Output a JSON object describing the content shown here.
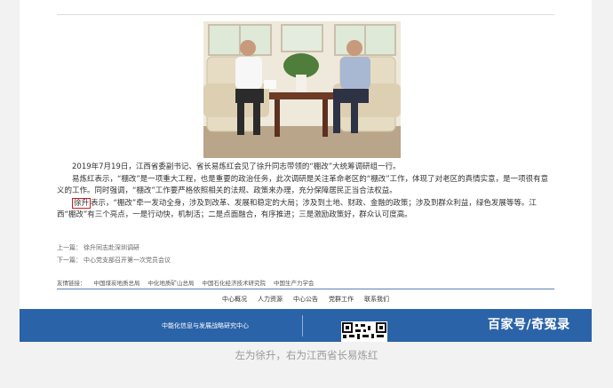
{
  "article": {
    "para1": "2019年7月19日，江西省委副书记、省长易炼红会见了徐升同志带领的“棚改”大统筹调研组一行。",
    "para2": "易炼红表示，“棚改”是一项重大工程，也是重要的政治任务，此次调研是关注革命老区的“棚改”工作，体现了对老区的真情实意，是一项很有意义的工作。同时强调，“棚改”工作要严格依照相关的法规、政策来办理，充分保障居民正当合法权益。",
    "para3_name": "徐升",
    "para3_rest": "表示，“棚改”牵一发动全身，涉及到改革、发展和稳定的大局；涉及到土地、财政、金融的政策；涉及到群众利益，绿色发展等等。江西“棚改”有三个亮点，一是行动快，机制活；二是点面融合，有序推进；三是激励政策好，群众认可度高。"
  },
  "nav": {
    "prev_label": "上一篇：",
    "prev_link": "徐升同志赴深圳调研",
    "next_label": "下一篇：",
    "next_link": "中心党支部召开第一次党员会议"
  },
  "friends": {
    "label": "友情链接：",
    "links": [
      "中国煤炭地质总局",
      "中化地质矿山总局",
      "中国石化经济技术研究院",
      "中国生产力学会"
    ]
  },
  "footer_nav": [
    "中心概况",
    "人力资源",
    "中心公告",
    "党群工作",
    "联系我们"
  ],
  "bar": {
    "title": "中能化信息与发展战略研究中心",
    "watermark": "百家号/奇冤录"
  },
  "caption": "左为徐升，右为江西省长易炼红",
  "colors": {
    "bar_blue": "#2b63a8",
    "highlight_red": "#d21b1b",
    "rule_blue": "#5a80b8"
  }
}
